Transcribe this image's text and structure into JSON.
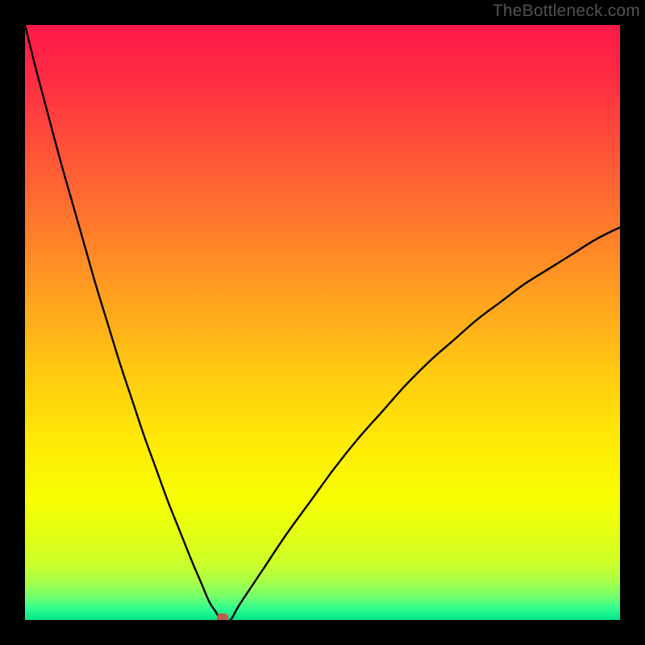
{
  "watermark": "TheBottleneck.com",
  "chart_data": {
    "type": "line",
    "title": "",
    "xlabel": "",
    "ylabel": "",
    "xlim": [
      0,
      100
    ],
    "ylim": [
      0,
      100
    ],
    "x": [
      0,
      2,
      4,
      6,
      8,
      10,
      12,
      14,
      16,
      18,
      20,
      22,
      24,
      26,
      28,
      29.5,
      31,
      32,
      33,
      34.5,
      36,
      40,
      44,
      48,
      52,
      56,
      60,
      64,
      68,
      72,
      76,
      80,
      84,
      88,
      92,
      96,
      100
    ],
    "y": [
      100,
      92,
      84.5,
      77,
      70,
      63,
      56,
      49.5,
      43,
      37,
      31,
      25.5,
      20,
      15,
      10,
      6.5,
      3,
      1.5,
      0,
      0,
      2.5,
      8.5,
      14.5,
      20,
      25.5,
      30.5,
      35,
      39.5,
      43.5,
      47,
      50.5,
      53.5,
      56.5,
      59,
      61.5,
      64,
      66
    ],
    "marker": {
      "x": 33.2,
      "y": 0.4
    },
    "gradient_stops": [
      {
        "offset": 0.0,
        "color": "#ff1848"
      },
      {
        "offset": 0.1,
        "color": "#ff2f42"
      },
      {
        "offset": 0.22,
        "color": "#ff5537"
      },
      {
        "offset": 0.34,
        "color": "#ff7a2b"
      },
      {
        "offset": 0.46,
        "color": "#ffa21e"
      },
      {
        "offset": 0.58,
        "color": "#ffc811"
      },
      {
        "offset": 0.7,
        "color": "#ffea05"
      },
      {
        "offset": 0.8,
        "color": "#f7ff02"
      },
      {
        "offset": 0.86,
        "color": "#e1ff15"
      },
      {
        "offset": 0.905,
        "color": "#ccff2a"
      },
      {
        "offset": 0.935,
        "color": "#a8ff47"
      },
      {
        "offset": 0.96,
        "color": "#74ff6a"
      },
      {
        "offset": 0.98,
        "color": "#34fd8f"
      },
      {
        "offset": 1.0,
        "color": "#00e48a"
      }
    ]
  }
}
